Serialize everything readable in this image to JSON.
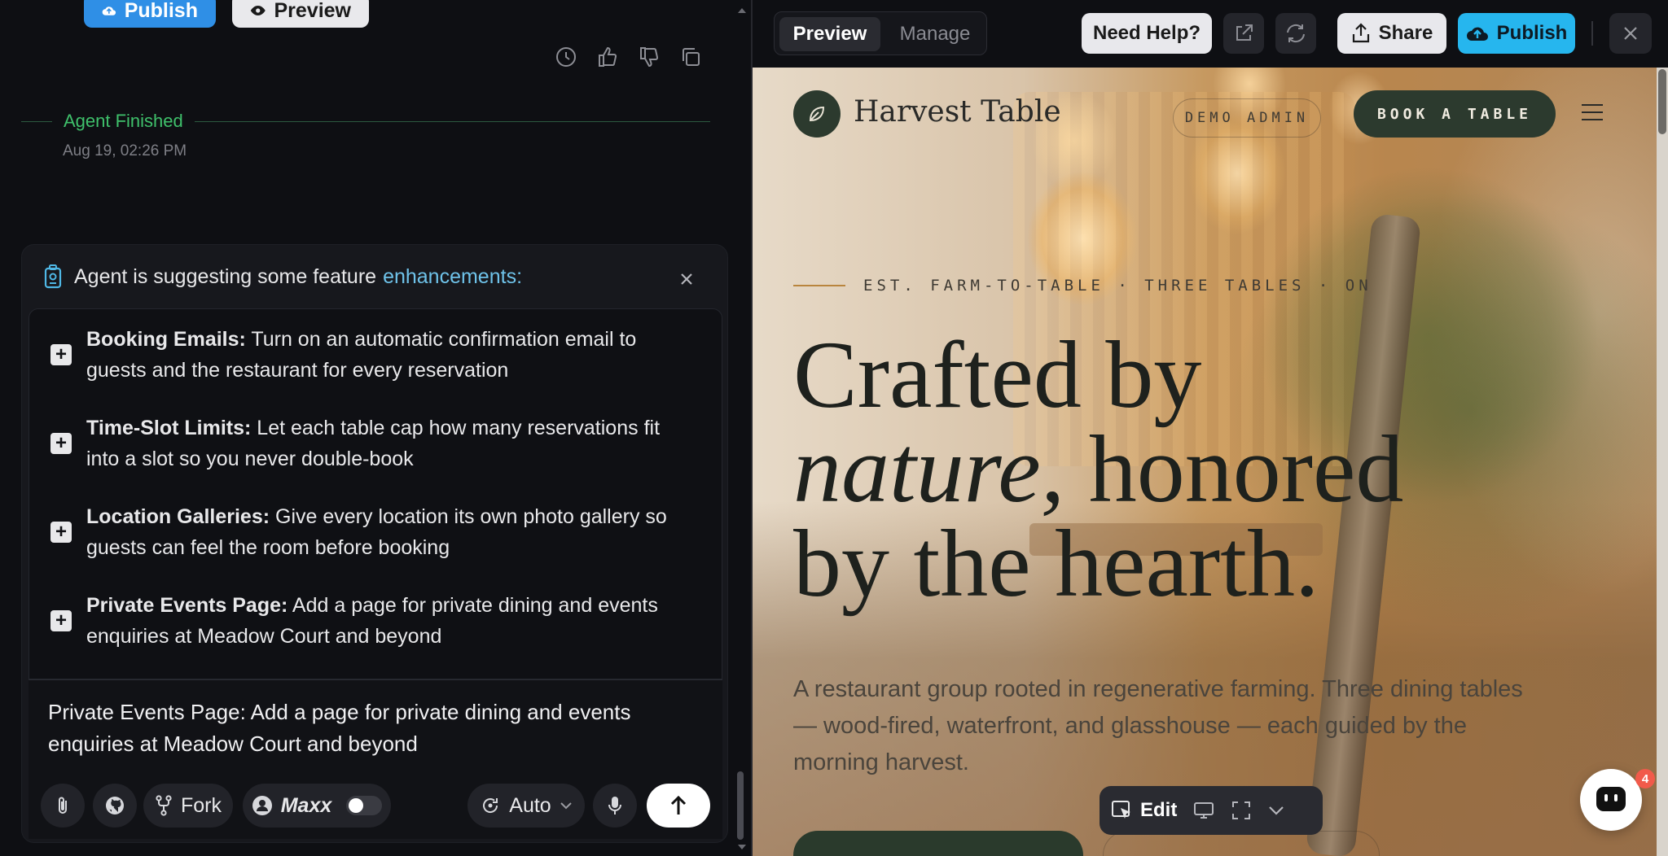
{
  "left": {
    "top_buttons": {
      "publish": "Publish",
      "preview": "Preview"
    },
    "status": {
      "label": "Agent Finished",
      "timestamp": "Aug 19, 02:26 PM"
    },
    "suggestions": {
      "heading_a": "Agent is suggesting some feature",
      "heading_b": "enhancements:",
      "items": [
        {
          "title": "Booking Emails:",
          "text": "Turn on an automatic confirmation email to guests and the restaurant for every reservation"
        },
        {
          "title": "Time-Slot Limits:",
          "text": "Let each table cap how many reservations fit into a slot so you never double-book"
        },
        {
          "title": "Location Galleries:",
          "text": "Give every location its own photo gallery so guests can feel the room before booking"
        },
        {
          "title": "Private Events Page:",
          "text": "Add a page for private dining and events enquiries at Meadow Court and beyond"
        }
      ]
    },
    "composer": {
      "text": "Private Events Page: Add a page for private dining and events enquiries at Meadow Court and beyond",
      "fork_label": "Fork",
      "maxx_label": "Maxx",
      "auto_label": "Auto"
    }
  },
  "right": {
    "tabs": {
      "preview": "Preview",
      "manage": "Manage"
    },
    "buttons": {
      "help": "Need Help?",
      "share": "Share",
      "publish": "Publish"
    },
    "site": {
      "brand": "Harvest Table",
      "admin": "DEMO ADMIN",
      "book": "BOOK A TABLE",
      "eyebrow": "EST. FARM-TO-TABLE · THREE TABLES · ON",
      "headline_1": "Crafted by",
      "headline_2_em": "nature,",
      "headline_2": " honored",
      "headline_3": "by the hearth.",
      "sub": "A restaurant group rooted in regenerative farming. Three dining tables — wood-fired, waterfront, and glasshouse — each guided by the morning harvest."
    },
    "toolbar": {
      "edit": "Edit"
    },
    "chat_badge": "4"
  },
  "colors": {
    "accent_blue": "#26b6ee",
    "success_green": "#3fc06b",
    "site_green": "#2c3a2e"
  }
}
